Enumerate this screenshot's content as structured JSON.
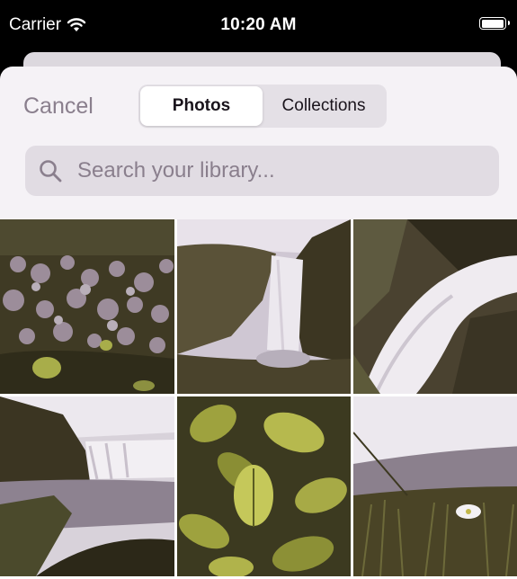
{
  "status_bar": {
    "carrier": "Carrier",
    "time": "10:20 AM",
    "battery_level": 1.0
  },
  "sheet": {
    "cancel_label": "Cancel",
    "tabs": [
      {
        "label": "Photos",
        "selected": true
      },
      {
        "label": "Collections",
        "selected": false
      }
    ],
    "search": {
      "placeholder": "Search your library...",
      "value": ""
    }
  },
  "photos": [
    {
      "subject": "flower-meadow"
    },
    {
      "subject": "waterfall-cliff"
    },
    {
      "subject": "waterfall-closeup"
    },
    {
      "subject": "waterfall-river"
    },
    {
      "subject": "leaves"
    },
    {
      "subject": "grass-flower"
    }
  ],
  "colors": {
    "accent_text": "#8a7f8d",
    "sheet_bg": "#f5f2f6",
    "search_bg": "#e1dce3"
  }
}
